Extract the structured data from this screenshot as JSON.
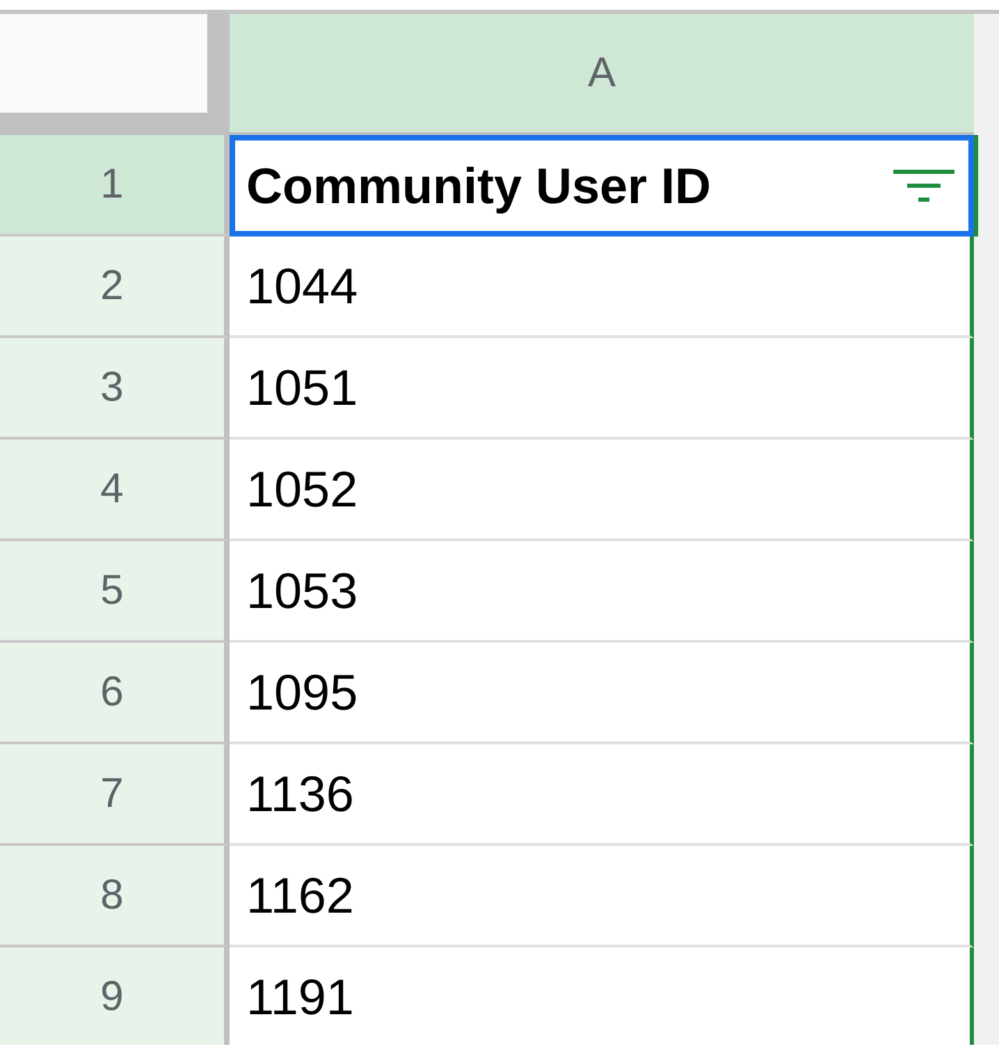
{
  "columns": [
    {
      "label": "A",
      "selected": true,
      "filtered": true
    }
  ],
  "rows": [
    {
      "number": "1",
      "selected": true,
      "kind": "header",
      "cells": [
        "Community User ID"
      ]
    },
    {
      "number": "2",
      "selected": false,
      "kind": "data",
      "cells": [
        "1044"
      ]
    },
    {
      "number": "3",
      "selected": false,
      "kind": "data",
      "cells": [
        "1051"
      ]
    },
    {
      "number": "4",
      "selected": false,
      "kind": "data",
      "cells": [
        "1052"
      ]
    },
    {
      "number": "5",
      "selected": false,
      "kind": "data",
      "cells": [
        "1053"
      ]
    },
    {
      "number": "6",
      "selected": false,
      "kind": "data",
      "cells": [
        "1095"
      ]
    },
    {
      "number": "7",
      "selected": false,
      "kind": "data",
      "cells": [
        "1136"
      ]
    },
    {
      "number": "8",
      "selected": false,
      "kind": "data",
      "cells": [
        "1162"
      ]
    },
    {
      "number": "9",
      "selected": false,
      "kind": "data",
      "cells": [
        "1191"
      ]
    }
  ]
}
